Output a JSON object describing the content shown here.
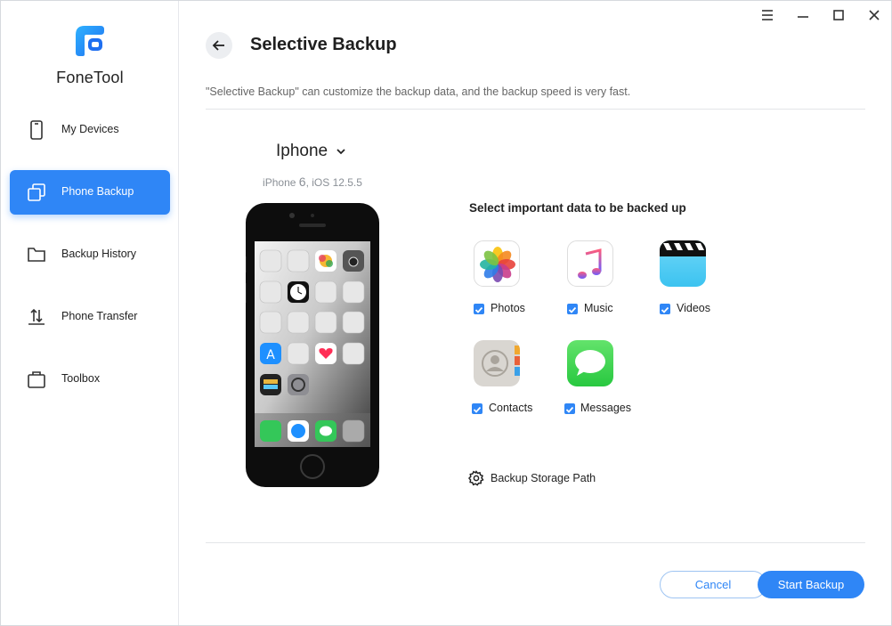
{
  "app": {
    "name": "FoneTool"
  },
  "sidebar": {
    "items": [
      {
        "label": "My Devices",
        "icon": "phone-icon",
        "active": false
      },
      {
        "label": "Phone Backup",
        "icon": "backup-copy-icon",
        "active": true
      },
      {
        "label": "Backup History",
        "icon": "folder-icon",
        "active": false
      },
      {
        "label": "Phone Transfer",
        "icon": "transfer-arrows-icon",
        "active": false
      },
      {
        "label": "Toolbox",
        "icon": "toolbox-icon",
        "active": false
      }
    ]
  },
  "window_controls": [
    "menu-icon",
    "minimize-icon",
    "maximize-icon",
    "close-icon"
  ],
  "header": {
    "title": "Selective Backup",
    "description": "\"Selective Backup\" can customize the backup data, and the backup speed is very fast."
  },
  "device": {
    "name": "Iphone",
    "model_prefix": "iPhone",
    "model_number": "6",
    "ios_version": ", iOS 12.5.5"
  },
  "selection": {
    "title": "Select important data to be backed up",
    "items": [
      {
        "label": "Photos",
        "icon": "photos-icon",
        "checked": true
      },
      {
        "label": "Music",
        "icon": "music-icon",
        "checked": true
      },
      {
        "label": "Videos",
        "icon": "videos-icon",
        "checked": true
      },
      {
        "label": "Contacts",
        "icon": "contacts-icon",
        "checked": true
      },
      {
        "label": "Messages",
        "icon": "messages-icon",
        "checked": true
      }
    ]
  },
  "storage_path": {
    "label": "Backup Storage Path"
  },
  "footer": {
    "cancel_label": "Cancel",
    "start_label": "Start Backup"
  },
  "colors": {
    "accent": "#2f86f6",
    "sidebar_active": "#2f86f6",
    "divider": "#e3e5e8"
  }
}
